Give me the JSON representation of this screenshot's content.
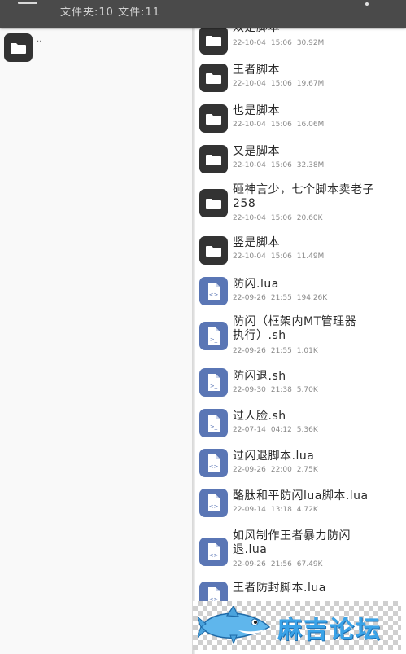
{
  "header": {
    "folder_count_label": "文件夹:10",
    "file_count_label": "文件:11",
    "menu_icon": "hamburger-menu-icon",
    "more_icon": "overflow-menu-icon",
    "bar_color": "#4a4a4a"
  },
  "left_pane": {
    "parent_label": ".."
  },
  "list": {
    "items": [
      {
        "name": "双是脚本",
        "date": "22-10-04",
        "time": "15:06",
        "size": "30.92M",
        "kind": "folder"
      },
      {
        "name": "王者脚本",
        "date": "22-10-04",
        "time": "15:06",
        "size": "19.67M",
        "kind": "folder"
      },
      {
        "name": "也是脚本",
        "date": "22-10-04",
        "time": "15:06",
        "size": "16.06M",
        "kind": "folder"
      },
      {
        "name": "又是脚本",
        "date": "22-10-04",
        "time": "15:06",
        "size": "32.38M",
        "kind": "folder"
      },
      {
        "name": "砸神言少，七个脚本卖老子258",
        "date": "22-10-04",
        "time": "15:06",
        "size": "20.60K",
        "kind": "folder"
      },
      {
        "name": "竖是脚本",
        "date": "22-10-04",
        "time": "15:06",
        "size": "11.49M",
        "kind": "folder"
      },
      {
        "name": "防闪.lua",
        "date": "22-09-26",
        "time": "21:55",
        "size": "194.26K",
        "kind": "code"
      },
      {
        "name": "防闪（框架内MT管理器执行）.sh",
        "date": "22-09-26",
        "time": "21:55",
        "size": "1.01K",
        "kind": "shell"
      },
      {
        "name": "防闪退.sh",
        "date": "22-09-30",
        "time": "21:38",
        "size": "5.70K",
        "kind": "shell"
      },
      {
        "name": "过人脸.sh",
        "date": "22-07-14",
        "time": "04:12",
        "size": "5.36K",
        "kind": "shell"
      },
      {
        "name": "过闪退脚本.lua",
        "date": "22-09-26",
        "time": "22:00",
        "size": "2.75K",
        "kind": "code"
      },
      {
        "name": "酪肽和平防闪lua脚本.lua",
        "date": "22-09-14",
        "time": "13:18",
        "size": "4.72K",
        "kind": "code"
      },
      {
        "name": "如风制作王者暴力防闪退.lua",
        "date": "22-09-26",
        "time": "21:56",
        "size": "67.49K",
        "kind": "code"
      },
      {
        "name": "王者防封脚本.lua",
        "date": "",
        "time": "",
        "size": "",
        "kind": "code"
      }
    ]
  },
  "watermark": {
    "text": "麻吉论坛",
    "mascot": "shark-mascot-icon",
    "color": "#3aa3e8"
  },
  "colors": {
    "folder_icon_bg": "#333333",
    "file_icon_bg": "#5a76b5"
  }
}
